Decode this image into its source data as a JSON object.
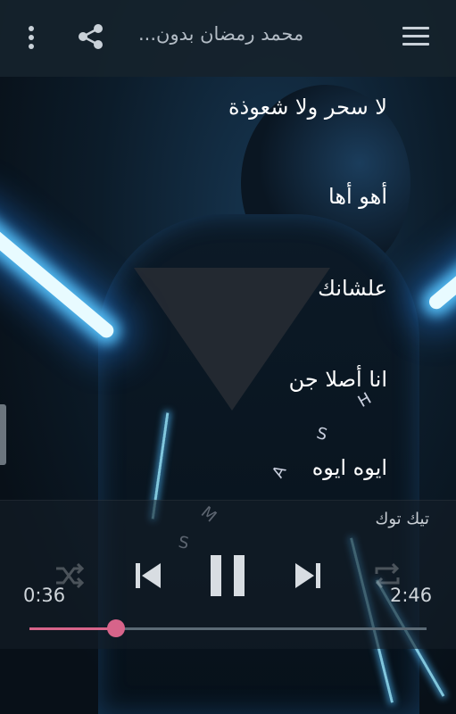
{
  "app": {
    "title": "محمد رمضان بدون..."
  },
  "toolbar": {
    "menu_icon": "hamburger-menu-icon",
    "share_icon": "share-icon",
    "more_icon": "more-vertical-icon"
  },
  "lyrics": [
    "لا سحر ولا شعوذة",
    "أهو أها",
    "علشانك",
    "انا أصلا جن",
    "ايوه ايوه"
  ],
  "player": {
    "track_name": "تيك توك",
    "current_time": "0:36",
    "total_time": "2:46",
    "progress": 0.217,
    "controls": [
      "shuffle-icon",
      "previous-icon",
      "pause-icon",
      "next-icon",
      "repeat-icon"
    ]
  },
  "colors": {
    "accent": "#d7648a",
    "topbar": "#16222c"
  }
}
